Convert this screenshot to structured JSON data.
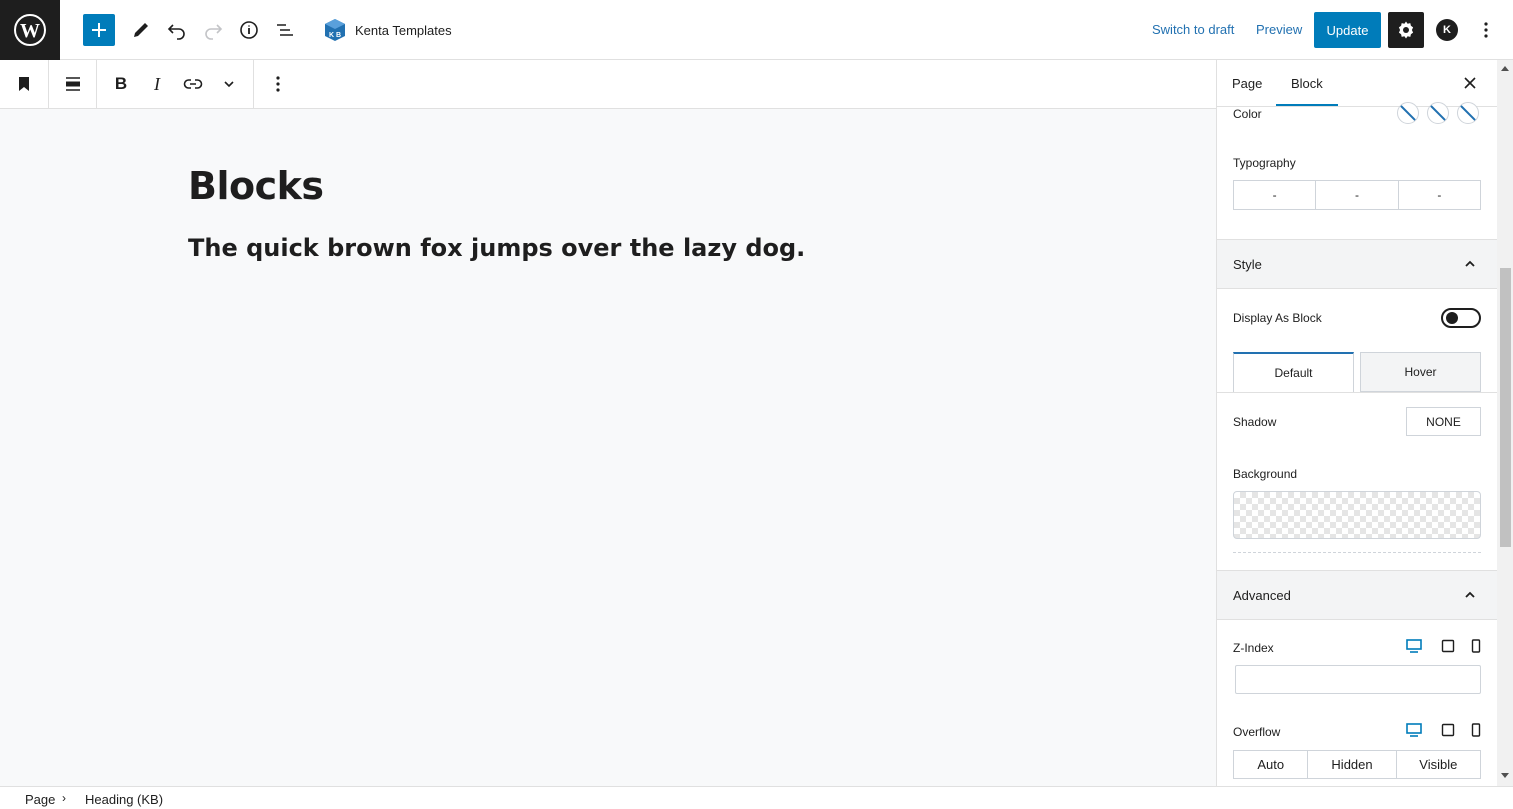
{
  "topbar": {
    "site_name": "Kenta Templates",
    "switch_to_draft": "Switch to draft",
    "preview": "Preview",
    "update": "Update",
    "avatar_letter": "K",
    "icons": [
      "wordpress-logo",
      "plus-icon",
      "pencil-icon",
      "undo-icon",
      "redo-icon",
      "info-icon",
      "list-view-icon",
      "kenta-blocks-logo",
      "gear-icon",
      "more-vertical-icon"
    ]
  },
  "block_toolbar": {
    "bold": "B",
    "italic": "I",
    "icons": [
      "bookmark-icon",
      "align-icon",
      "link-icon",
      "chevron-down-icon",
      "more-vertical-icon"
    ]
  },
  "canvas": {
    "heading": "Blocks",
    "subheading": "The quick brown fox jumps over the lazy dog."
  },
  "breadcrumb": {
    "items": [
      "Page",
      "Heading (KB)"
    ],
    "separator": "›"
  },
  "sidebar": {
    "tabs": [
      "Page",
      "Block"
    ],
    "active_tab": "Block",
    "close": "×",
    "color_label": "Color",
    "typography_label": "Typography",
    "typography_cells": [
      "-",
      "-",
      "-"
    ],
    "style": {
      "title": "Style",
      "display_as_block": "Display As Block",
      "display_as_block_on": false,
      "state_tabs": [
        "Default",
        "Hover"
      ],
      "active_state": "Default",
      "shadow_label": "Shadow",
      "shadow_value": "NONE",
      "background_label": "Background"
    },
    "advanced": {
      "title": "Advanced",
      "z_index_label": "Z-Index",
      "z_index_value": "",
      "overflow_label": "Overflow",
      "overflow_options": [
        "Auto",
        "Hidden",
        "Visible"
      ]
    }
  },
  "colors": {
    "accent": "#007cba",
    "link": "#2271b1",
    "dark": "#1e1e1e",
    "canvas_bg": "#f8f9fa"
  }
}
